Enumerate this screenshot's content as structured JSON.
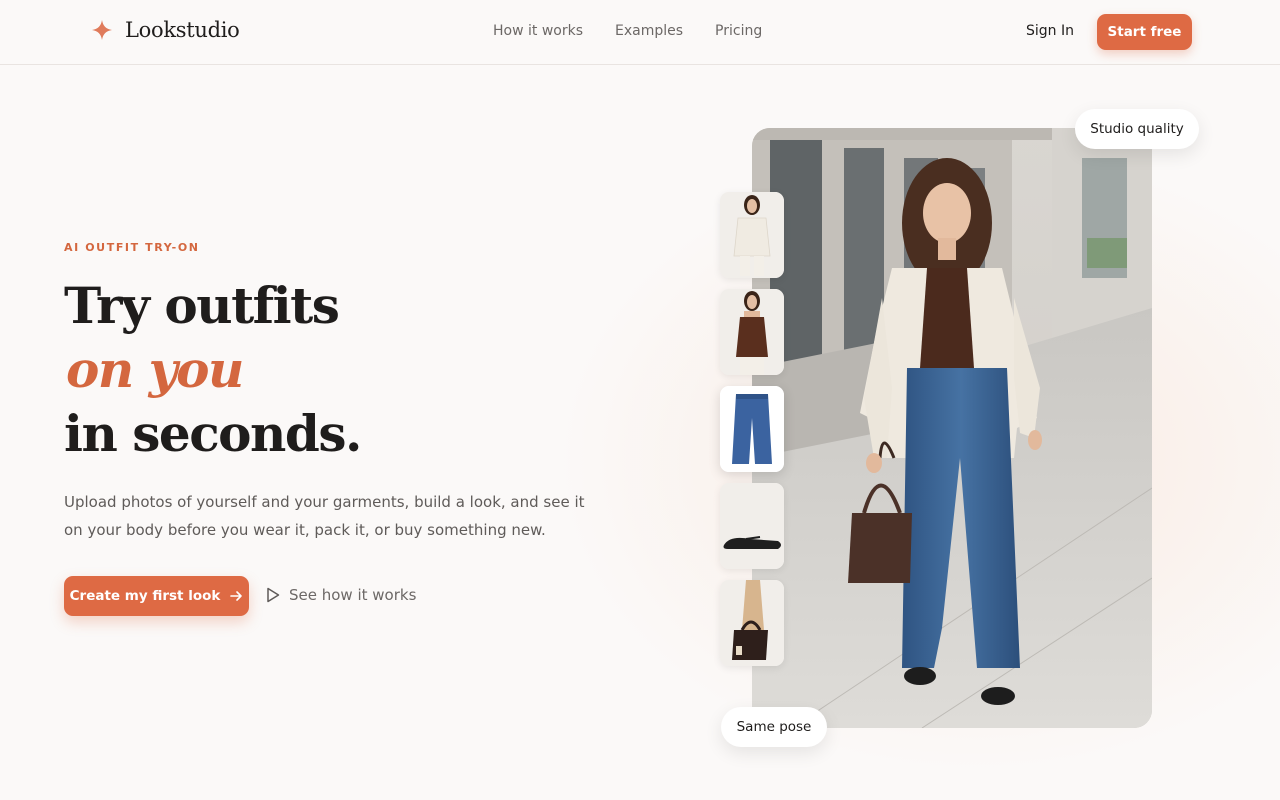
{
  "brand": {
    "name": "Lookstudio",
    "accent_color": "#de6a44",
    "icon": "sparkle-icon"
  },
  "nav": {
    "items": [
      "How it works",
      "Examples",
      "Pricing"
    ]
  },
  "header": {
    "sign_in": "Sign In",
    "start_free": "Start free"
  },
  "hero": {
    "eyebrow": "AI OUTFIT TRY-ON",
    "headline_line1": "Try outfits",
    "headline_accent": "on you",
    "headline_line3": "in seconds.",
    "description": "Upload photos of yourself and your garments, build a look, and see it on your body before you wear it, pack it, or buy something new.",
    "primary_cta": "Create my first look",
    "secondary_cta": "See how it works"
  },
  "visual": {
    "badge_top": "Studio quality",
    "badge_bottom": "Same pose",
    "garments": [
      "blazer",
      "camisole",
      "jeans",
      "flats",
      "handbag"
    ],
    "selected_garment": "jeans"
  }
}
